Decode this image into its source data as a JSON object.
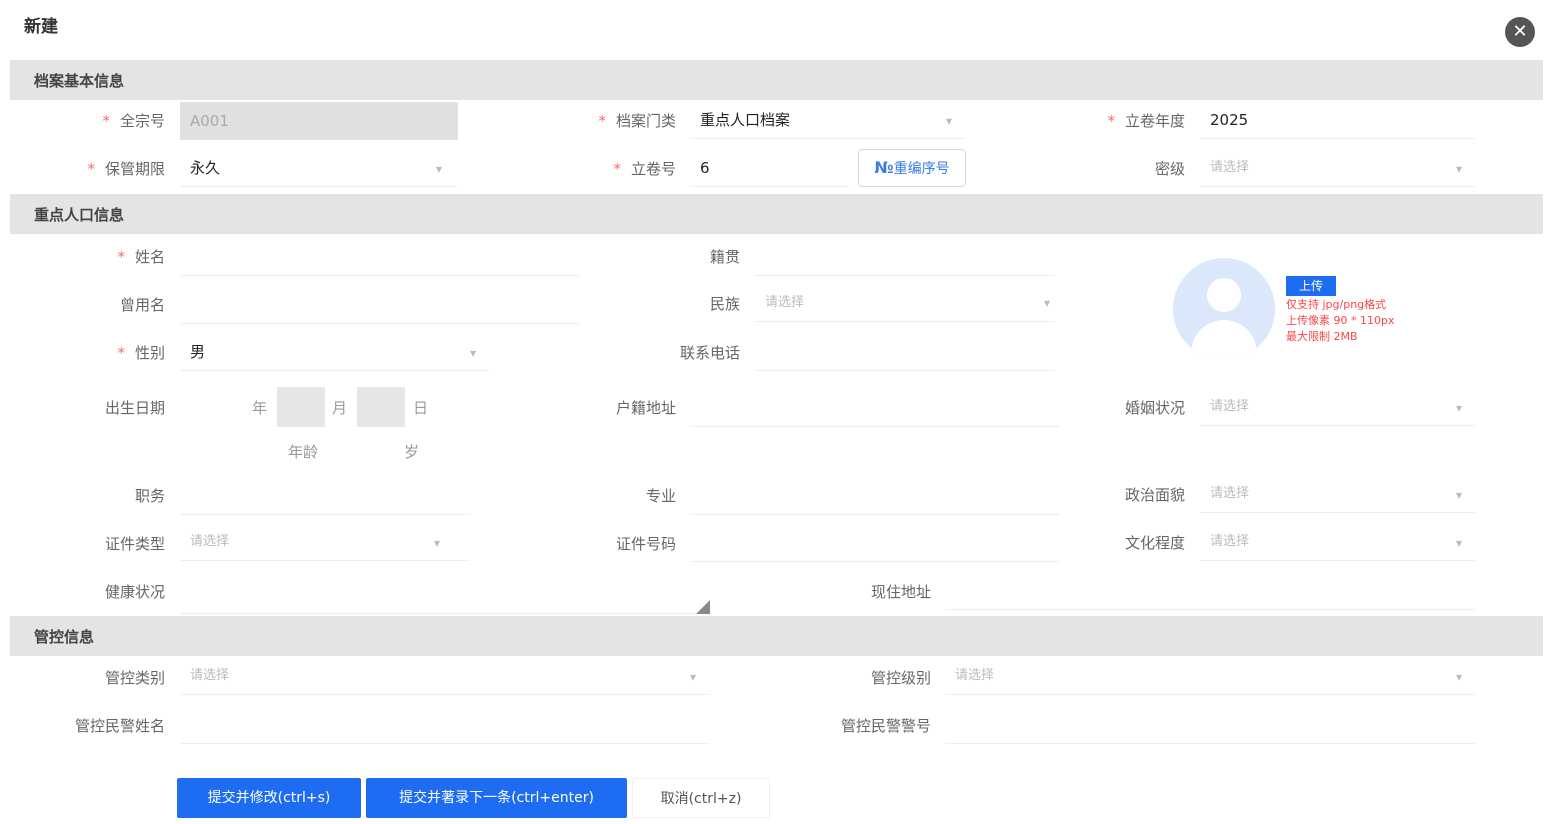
{
  "dialog": {
    "title": "新建",
    "close_glyph": "✕"
  },
  "sections": {
    "basic": "档案基本信息",
    "population": "重点人口信息",
    "control": "管控信息"
  },
  "basic": {
    "quanzong_label": "全宗号",
    "quanzong_value": "A001",
    "category_label": "档案门类",
    "category_value": "重点人口档案",
    "year_label": "立卷年度",
    "year_value": "2025",
    "retention_label": "保管期限",
    "retention_value": "永久",
    "volume_label": "立卷号",
    "volume_value": "6",
    "no_button_glyph": "№",
    "no_button_label": "重编序号",
    "secret_label": "密级",
    "secret_placeholder": "请选择"
  },
  "person": {
    "name_label": "姓名",
    "origin_label": "籍贯",
    "alias_label": "曾用名",
    "ethnic_label": "民族",
    "ethnic_placeholder": "请选择",
    "gender_label": "性别",
    "gender_value": "男",
    "phone_label": "联系电话",
    "birth_label": "出生日期",
    "year_unit": "年",
    "month_unit": "月",
    "day_unit": "日",
    "age_label": "年龄",
    "age_unit": "岁",
    "household_label": "户籍地址",
    "marital_label": "婚姻状况",
    "marital_placeholder": "请选择",
    "job_label": "职务",
    "major_label": "专业",
    "political_label": "政治面貌",
    "political_placeholder": "请选择",
    "idtype_label": "证件类型",
    "idtype_placeholder": "请选择",
    "idno_label": "证件号码",
    "education_label": "文化程度",
    "education_placeholder": "请选择",
    "health_label": "健康状况",
    "residence_label": "现住地址",
    "upload_label": "上传",
    "hint_lines": [
      "仅支持 jpg/png格式",
      "上传像素 90 * 110px",
      "最大限制 2MB"
    ]
  },
  "control": {
    "type_label": "管控类别",
    "type_placeholder": "请选择",
    "level_label": "管控级别",
    "level_placeholder": "请选择",
    "officer_name_label": "管控民警姓名",
    "officer_no_label": "管控民警警号"
  },
  "actions": {
    "submit_edit": "提交并修改(ctrl+s)",
    "submit_next": "提交并著录下一条(ctrl+enter)",
    "cancel": "取消(ctrl+z)"
  },
  "colors": {
    "primary": "#1e6cf2",
    "required": "#f56c6c",
    "section_bg": "#e4e4e4"
  },
  "icons": {
    "close": "close-icon",
    "dropdown": "chevron-down-icon",
    "avatar": "user-avatar-icon",
    "resize": "resize-handle-icon"
  }
}
